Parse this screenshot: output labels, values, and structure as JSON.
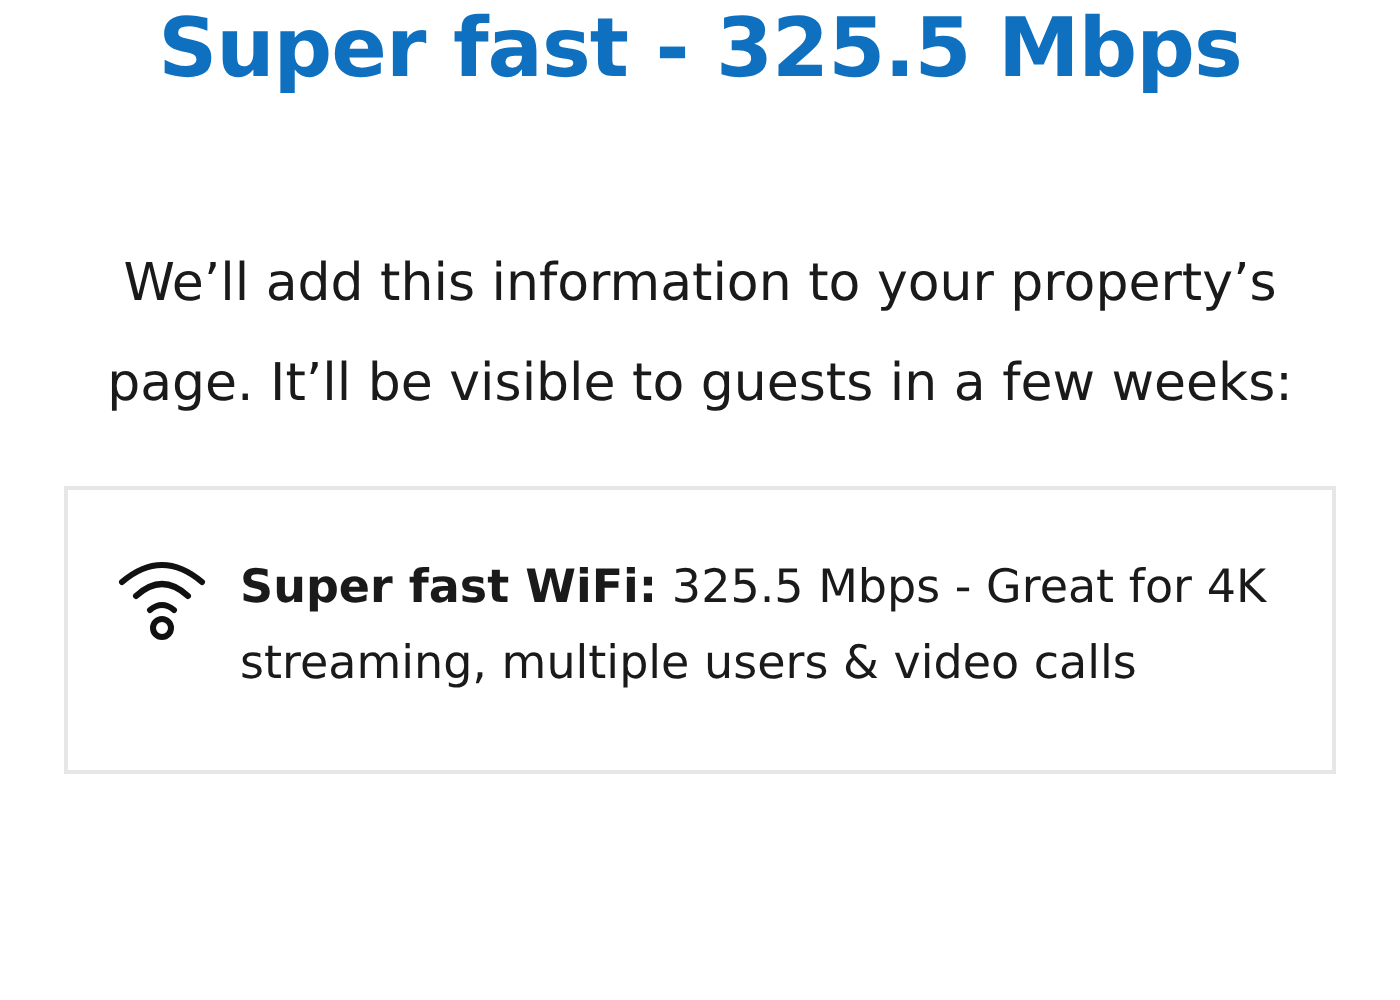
{
  "heading": "Super fast - 325.5 Mbps",
  "message": "We’ll add this information to your property’s page. It’ll be visible to guests in a few weeks:",
  "wifi_card": {
    "text": "**Super fast WiFi:** 325.5 Mbps - Great for 4K streaming, multiple users & video calls"
  }
}
